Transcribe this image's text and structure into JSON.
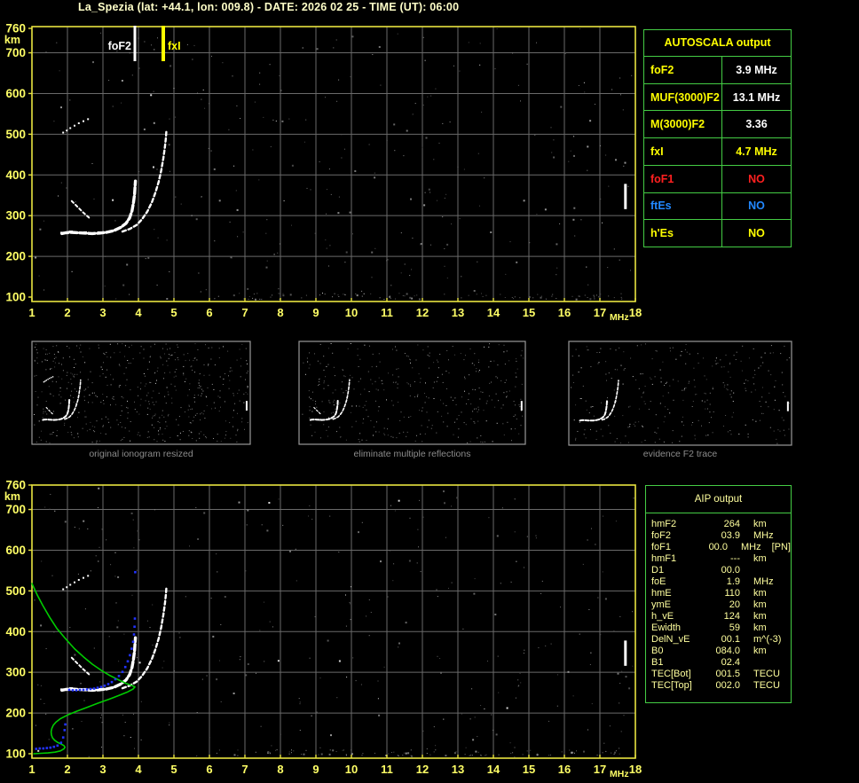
{
  "title": "La_Spezia (lat: +44.1, lon: 009.8) - DATE: 2026 02 25 - TIME (UT): 06:00",
  "colors": {
    "background": "#000000",
    "title_text": "#ffffc8",
    "axis_label": "#ffff66",
    "plot_border": "#e8e340",
    "grid": "#6a6a6a",
    "trace": "#ffffff",
    "table_border": "#44cc44",
    "autoscala_header": "#ffff00",
    "aip_text": "#ffff9e",
    "caption_text": "#8c8c8c",
    "profile_green": "#00cc00",
    "restored_blue": "#2233ff",
    "red": "#ff2020",
    "blue": "#2288ff",
    "yellow": "#ffff00",
    "white": "#ffffff",
    "thumb_border": "#9a9a9a"
  },
  "autoscala": {
    "header": "AUTOSCALA output",
    "rows": [
      {
        "label": "foF2",
        "value": "3.9 MHz",
        "label_color": "#ffff00",
        "value_color": "#ffffff"
      },
      {
        "label": "MUF(3000)F2",
        "value": "13.1 MHz",
        "label_color": "#ffff00",
        "value_color": "#ffffff"
      },
      {
        "label": "M(3000)F2",
        "value": "3.36",
        "label_color": "#ffff00",
        "value_color": "#ffffff"
      },
      {
        "label": "fxI",
        "value": "4.7 MHz",
        "label_color": "#ffff00",
        "value_color": "#ffff00"
      },
      {
        "label": "foF1",
        "value": "NO",
        "label_color": "#ff2020",
        "value_color": "#ff2020"
      },
      {
        "label": "ftEs",
        "value": "NO",
        "label_color": "#2288ff",
        "value_color": "#2288ff"
      },
      {
        "label": "h'Es",
        "value": "NO",
        "label_color": "#ffff00",
        "value_color": "#ffff00"
      }
    ]
  },
  "aip": {
    "header": "AIP output",
    "rows": [
      {
        "name": "hmF2",
        "value": "264",
        "unit": "km",
        "flag": ""
      },
      {
        "name": "foF2",
        "value": "03.9",
        "unit": "MHz",
        "flag": ""
      },
      {
        "name": "foF1",
        "value": "00.0",
        "unit": "MHz",
        "flag": "[PN]"
      },
      {
        "name": "hmF1",
        "value": "---",
        "unit": "km",
        "flag": ""
      },
      {
        "name": "D1",
        "value": "00.0",
        "unit": "",
        "flag": ""
      },
      {
        "name": "foE",
        "value": "1.9",
        "unit": "MHz",
        "flag": ""
      },
      {
        "name": "hmE",
        "value": "110",
        "unit": "km",
        "flag": ""
      },
      {
        "name": "ymE",
        "value": "20",
        "unit": "km",
        "flag": ""
      },
      {
        "name": "h_vE",
        "value": "124",
        "unit": "km",
        "flag": ""
      },
      {
        "name": "Ewidth",
        "value": "59",
        "unit": "km",
        "flag": ""
      },
      {
        "name": "DelN_vE",
        "value": "00.1",
        "unit": "m^(-3)",
        "flag": ""
      },
      {
        "name": "B0",
        "value": "084.0",
        "unit": "km",
        "flag": ""
      },
      {
        "name": "B1",
        "value": "02.4",
        "unit": "",
        "flag": ""
      },
      {
        "name": "TEC[Bot]",
        "value": "001.5",
        "unit": "TECU",
        "flag": ""
      },
      {
        "name": "TEC[Top]",
        "value": "002.0",
        "unit": "TECU",
        "flag": ""
      }
    ]
  },
  "thumbnails": [
    {
      "caption": "original ionogram resized"
    },
    {
      "caption": "eliminate multiple reflections"
    },
    {
      "caption": "evidence F2 trace"
    }
  ],
  "markers": {
    "foF2": {
      "label": "foF2",
      "freq_mhz": 3.9,
      "color": "#ffffff"
    },
    "fxI": {
      "label": "fxI",
      "freq_mhz": 4.7,
      "color": "#ffff00"
    }
  },
  "chart_data": {
    "type": "scatter",
    "title": "Ionogram - La Spezia 2026-02-25 06:00 UT",
    "xlabel": "MHz",
    "ylabel": "km",
    "x_axis": {
      "min": 1,
      "max": 18,
      "ticks": [
        1,
        2,
        3,
        4,
        5,
        6,
        7,
        8,
        9,
        10,
        11,
        12,
        13,
        14,
        15,
        16,
        17,
        18
      ],
      "unit": "MHz"
    },
    "y_axis": {
      "min": 100,
      "max": 760,
      "ticks": [
        760,
        700,
        600,
        500,
        400,
        300,
        200,
        100
      ],
      "unit": "km"
    },
    "grid": {
      "x_step_mhz": 1,
      "y_step_km": 100
    },
    "series": {
      "f2_trace_ordinary": [
        [
          1.85,
          256
        ],
        [
          1.95,
          258
        ],
        [
          2.1,
          259
        ],
        [
          2.3,
          258
        ],
        [
          2.5,
          257
        ],
        [
          2.7,
          256
        ],
        [
          2.9,
          257
        ],
        [
          3.1,
          259
        ],
        [
          3.3,
          263
        ],
        [
          3.5,
          271
        ],
        [
          3.65,
          281
        ],
        [
          3.75,
          294
        ],
        [
          3.82,
          312
        ],
        [
          3.86,
          332
        ],
        [
          3.89,
          352
        ],
        [
          3.905,
          372
        ],
        [
          3.915,
          385
        ]
      ],
      "f2_trace_extraordinary": [
        [
          3.55,
          261
        ],
        [
          3.75,
          267
        ],
        [
          3.95,
          277
        ],
        [
          4.1,
          291
        ],
        [
          4.25,
          310
        ],
        [
          4.38,
          333
        ],
        [
          4.48,
          357
        ],
        [
          4.57,
          383
        ],
        [
          4.64,
          410
        ],
        [
          4.7,
          440
        ],
        [
          4.745,
          468
        ],
        [
          4.775,
          492
        ],
        [
          4.79,
          512
        ]
      ],
      "low_spur": [
        [
          2.12,
          336
        ],
        [
          2.28,
          322
        ],
        [
          2.44,
          308
        ],
        [
          2.62,
          294
        ]
      ],
      "second_hop_dots": [
        [
          1.88,
          504
        ],
        [
          1.98,
          509
        ],
        [
          2.08,
          515
        ],
        [
          2.2,
          521
        ],
        [
          2.32,
          527
        ],
        [
          2.45,
          532
        ],
        [
          2.58,
          537
        ]
      ],
      "interference_dash": {
        "freq_mhz": 17.72,
        "km_range": [
          316,
          378
        ]
      },
      "restored_trace_blue": [
        [
          2.05,
          257
        ],
        [
          2.15,
          256
        ],
        [
          2.25,
          256
        ],
        [
          2.35,
          257
        ],
        [
          2.45,
          257
        ],
        [
          2.55,
          258
        ],
        [
          2.65,
          259
        ],
        [
          2.75,
          260
        ],
        [
          2.85,
          262
        ],
        [
          2.95,
          264
        ],
        [
          3.05,
          267
        ],
        [
          3.15,
          271
        ],
        [
          3.25,
          276
        ],
        [
          3.35,
          283
        ],
        [
          3.45,
          291
        ],
        [
          3.55,
          301
        ],
        [
          3.63,
          313
        ],
        [
          3.7,
          327
        ],
        [
          3.76,
          342
        ],
        [
          3.81,
          358
        ],
        [
          3.85,
          375
        ],
        [
          3.875,
          393
        ],
        [
          3.89,
          412
        ],
        [
          3.9,
          432
        ],
        [
          3.91,
          546
        ]
      ],
      "restored_trace_blue_E": [
        [
          1.12,
          112
        ],
        [
          1.22,
          113
        ],
        [
          1.32,
          113
        ],
        [
          1.42,
          114
        ],
        [
          1.52,
          115
        ],
        [
          1.62,
          117
        ],
        [
          1.72,
          120
        ],
        [
          1.82,
          127
        ],
        [
          1.88,
          140
        ],
        [
          1.92,
          158
        ],
        [
          1.94,
          172
        ]
      ],
      "density_profile_green": [
        [
          1.0,
          518
        ],
        [
          1.15,
          490
        ],
        [
          1.3,
          465
        ],
        [
          1.5,
          435
        ],
        [
          1.7,
          408
        ],
        [
          1.95,
          382
        ],
        [
          2.2,
          358
        ],
        [
          2.45,
          338
        ],
        [
          2.7,
          320
        ],
        [
          2.95,
          305
        ],
        [
          3.2,
          292
        ],
        [
          3.45,
          281
        ],
        [
          3.65,
          273
        ],
        [
          3.8,
          268
        ],
        [
          3.88,
          265
        ],
        [
          3.9,
          264
        ],
        [
          3.85,
          259
        ],
        [
          3.7,
          252
        ],
        [
          3.45,
          243
        ],
        [
          3.15,
          233
        ],
        [
          2.85,
          224
        ],
        [
          2.55,
          214
        ],
        [
          2.25,
          204
        ],
        [
          2.0,
          195
        ],
        [
          1.8,
          186
        ],
        [
          1.68,
          178
        ],
        [
          1.6,
          170
        ],
        [
          1.56,
          162
        ],
        [
          1.54,
          154
        ],
        [
          1.55,
          146
        ],
        [
          1.58,
          139
        ],
        [
          1.64,
          133
        ],
        [
          1.72,
          128
        ],
        [
          1.82,
          124
        ],
        [
          1.9,
          120
        ],
        [
          1.93,
          116
        ],
        [
          1.9,
          112
        ],
        [
          1.8,
          107
        ],
        [
          1.65,
          104
        ],
        [
          1.45,
          102
        ],
        [
          1.25,
          101
        ],
        [
          1.05,
          100
        ]
      ]
    },
    "noise": {
      "plot_seeds": [
        42,
        137
      ],
      "plot_dot_count": 280,
      "bright_dot_count": 22,
      "band_dot_count": 90,
      "thumb_seeds": [
        7,
        21,
        63
      ],
      "thumb_dot_counts": [
        520,
        380,
        300
      ]
    }
  }
}
